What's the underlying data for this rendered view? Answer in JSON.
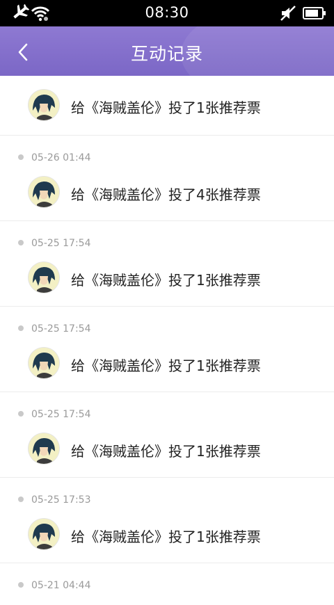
{
  "status_bar": {
    "time": "08:30"
  },
  "header": {
    "title": "互动记录"
  },
  "records": [
    {
      "time": "",
      "text": "给《海贼盖伦》投了1张推荐票"
    },
    {
      "time": "05-26 01:44",
      "text": "给《海贼盖伦》投了4张推荐票"
    },
    {
      "time": "05-25 17:54",
      "text": "给《海贼盖伦》投了1张推荐票"
    },
    {
      "time": "05-25 17:54",
      "text": "给《海贼盖伦》投了1张推荐票"
    },
    {
      "time": "05-25 17:54",
      "text": "给《海贼盖伦》投了1张推荐票"
    },
    {
      "time": "05-25 17:53",
      "text": "给《海贼盖伦》投了1张推荐票"
    },
    {
      "time": "05-21 04:44",
      "text": ""
    }
  ]
}
